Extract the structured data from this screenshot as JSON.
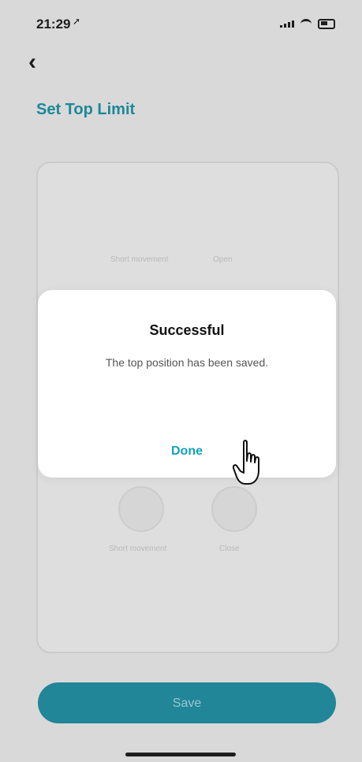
{
  "status_bar": {
    "time": "21:29",
    "location_icon": "location-arrow-icon",
    "signal_icon": "cellular-signal-icon",
    "wifi_icon": "wifi-icon",
    "battery_icon": "battery-icon"
  },
  "nav": {
    "back_icon": "chevron-left-icon",
    "back_glyph": "‹"
  },
  "page": {
    "title": "Set Top Limit"
  },
  "card": {
    "labels": [
      "Short movement",
      "Open",
      "Short movement",
      "Close"
    ]
  },
  "footer": {
    "save_label": "Save"
  },
  "dialog": {
    "title": "Successful",
    "message": "The top position has been saved.",
    "done_label": "Done"
  },
  "colors": {
    "accent": "#14a3bd",
    "title_teal": "#0f8a9e",
    "save_bg": "#15889b"
  },
  "cursor_icon": "pointing-hand-cursor-icon"
}
